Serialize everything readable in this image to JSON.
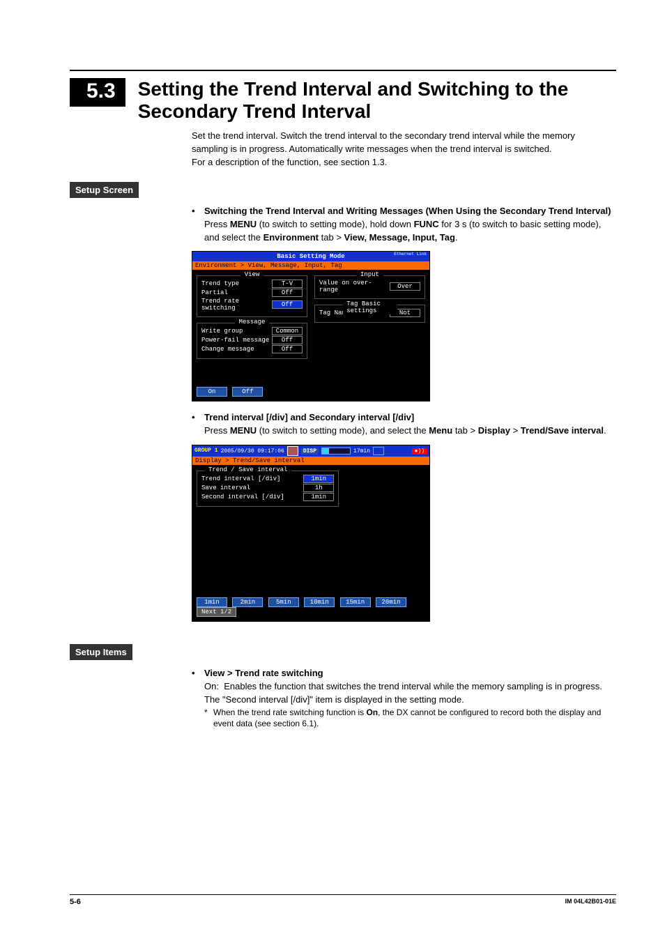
{
  "section": {
    "number": "5.3",
    "title": "Setting the Trend Interval and Switching to the Secondary Trend Interval"
  },
  "intro": {
    "p1": "Set the trend interval. Switch the trend interval to the secondary trend interval while the memory sampling is in progress. Automatically write messages when the trend interval is switched.",
    "p2": "For a description of the function, see section 1.3."
  },
  "setup_screen": {
    "label": "Setup Screen",
    "bullets": {
      "b1_title": "Switching the Trend Interval and Writing Messages (When Using the Secondary Trend Interval)",
      "b1_text_a": "Press ",
      "b1_menu": "MENU",
      "b1_text_b": " (to switch to setting mode), hold down ",
      "b1_func": "FUNC",
      "b1_text_c": " for 3 s (to switch to basic setting mode), and select the ",
      "b1_env": "Environment",
      "b1_text_d": " tab > ",
      "b1_path": "View, Message, Input, Tag",
      "b2_title": "Trend interval [/div] and Secondary interval [/div]",
      "b2_text_a": "Press ",
      "b2_menu": "MENU",
      "b2_text_b": " (to switch to setting mode), and select the ",
      "b2_menu2": "Menu",
      "b2_text_c": " tab > ",
      "b2_display": "Display",
      "b2_text_d": " > ",
      "b2_trend": "Trend/Save interval",
      "b2_period": "."
    }
  },
  "screenshot1": {
    "title": "Basic Setting Mode",
    "eth": "Ethernet\nLink",
    "path": "Environment > View, Message, Input, Tag",
    "view": {
      "legend": "View",
      "items": {
        "trend_type_k": "Trend type",
        "trend_type_v": "T-V",
        "partial_k": "Partial",
        "partial_v": "Off",
        "trs_k": "Trend rate switching",
        "trs_v": "Off"
      }
    },
    "message": {
      "legend": "Message",
      "items": {
        "wg_k": "Write group",
        "wg_v": "Common",
        "pf_k": "Power-fail message",
        "pf_v": "Off",
        "cm_k": "Change message",
        "cm_v": "Off"
      }
    },
    "input": {
      "legend": "Input",
      "items": {
        "vor_k": "Value on over-range",
        "vor_v": "Over"
      }
    },
    "tag": {
      "legend": "Tag Basic settings",
      "items": {
        "tn_k": "Tag Name Use/Not",
        "tn_v": "Not"
      }
    },
    "footer": {
      "on": "On",
      "off": "Off"
    }
  },
  "screenshot2": {
    "group": "GROUP 1",
    "ts": "2005/09/30 09:17:06",
    "disp": "DISP",
    "time": "17min",
    "path": "Display > Trend/Save interval",
    "box": {
      "legend": "Trend / Save interval",
      "items": {
        "ti_k": "Trend interval [/div]",
        "ti_v": "1min",
        "si_k": "Save interval",
        "si_v": "1h",
        "sec_k": "Second interval [/div]",
        "sec_v": "1min"
      }
    },
    "footer": {
      "b1": "1min",
      "b2": "2min",
      "b3": "5min",
      "b4": "10min",
      "b5": "15min",
      "b6": "20min",
      "next": "Next 1/2"
    }
  },
  "setup_items": {
    "label": "Setup Items",
    "bullet_title": "View > Trend rate switching",
    "on_label": "On:",
    "on_text": "Enables the function that switches the trend interval while the memory sampling is in progress. The \"Second interval [/div]\" item is displayed in the setting mode.",
    "note_a": "When the trend rate switching function is ",
    "note_on": "On",
    "note_b": ", the DX cannot be configured to record both the display and event data (see section 6.1)."
  },
  "footer": {
    "page": "5-6",
    "doc": "IM 04L42B01-01E"
  }
}
